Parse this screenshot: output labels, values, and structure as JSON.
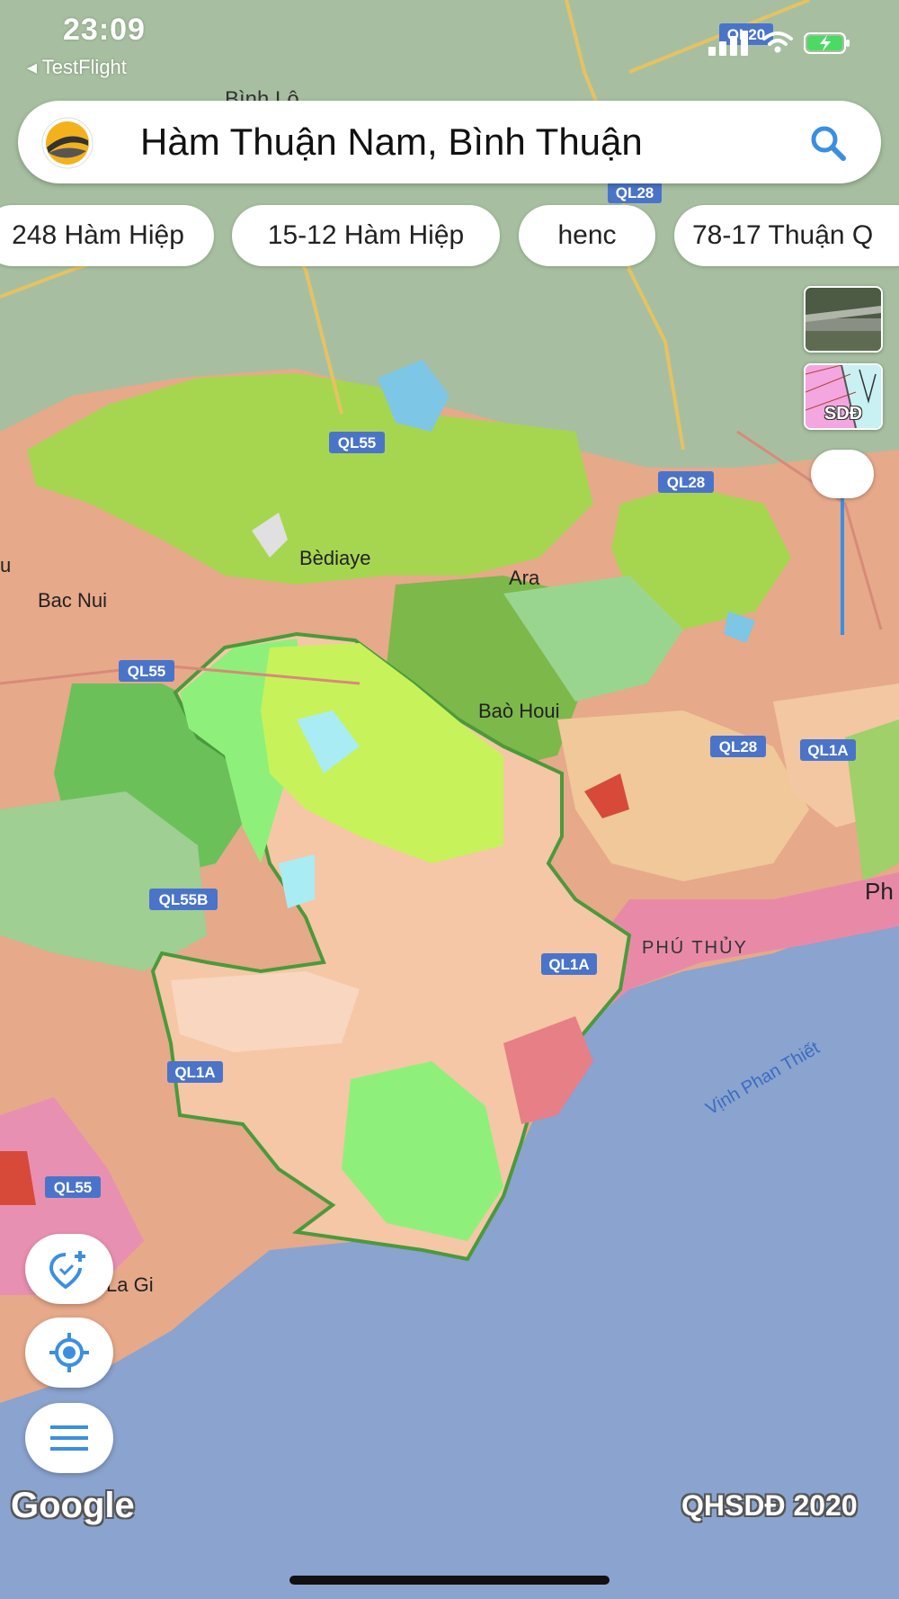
{
  "status_bar": {
    "time": "23:09",
    "back_label": "◂ TestFlight"
  },
  "search": {
    "query": "Hàm Thuận Nam, Bình Thuận"
  },
  "chips": [
    "248 Hàm Hiệp",
    "15-12 Hàm Hiệp",
    "henc",
    "78-17 Thuận Q"
  ],
  "layers": {
    "land_use_label": "SDĐ"
  },
  "map": {
    "places": {
      "bediaye": "Bèdiaye",
      "ara": "Ara",
      "bac_nui": "Bac Nui",
      "bao_houi": "Baò Houi",
      "phu_thuy": "PHÚ THỦY",
      "la_gi": "La Gi",
      "bay": "Vịnh Phan Thiết",
      "phan_edge": "Ph",
      "u_edge": "u",
      "top_cut": "Bình Lộ"
    },
    "roads": {
      "ql20": "QL20",
      "ql28_a": "QL28",
      "ql55_a": "QL55",
      "ql28_b": "QL28",
      "ql55_b": "QL55",
      "ql28_c": "QL28",
      "ql1a_a": "QL1A",
      "ql55b": "QL55B",
      "ql1a_b": "QL1A",
      "ql1a_c": "QL1A",
      "ql55_c": "QL55"
    }
  },
  "footer": {
    "google": "Google",
    "credit": "QHSDĐ 2020"
  },
  "colors": {
    "sea": "#8aa3cf",
    "boundary": "#4a9a3c",
    "accent": "#3b8fe0"
  }
}
